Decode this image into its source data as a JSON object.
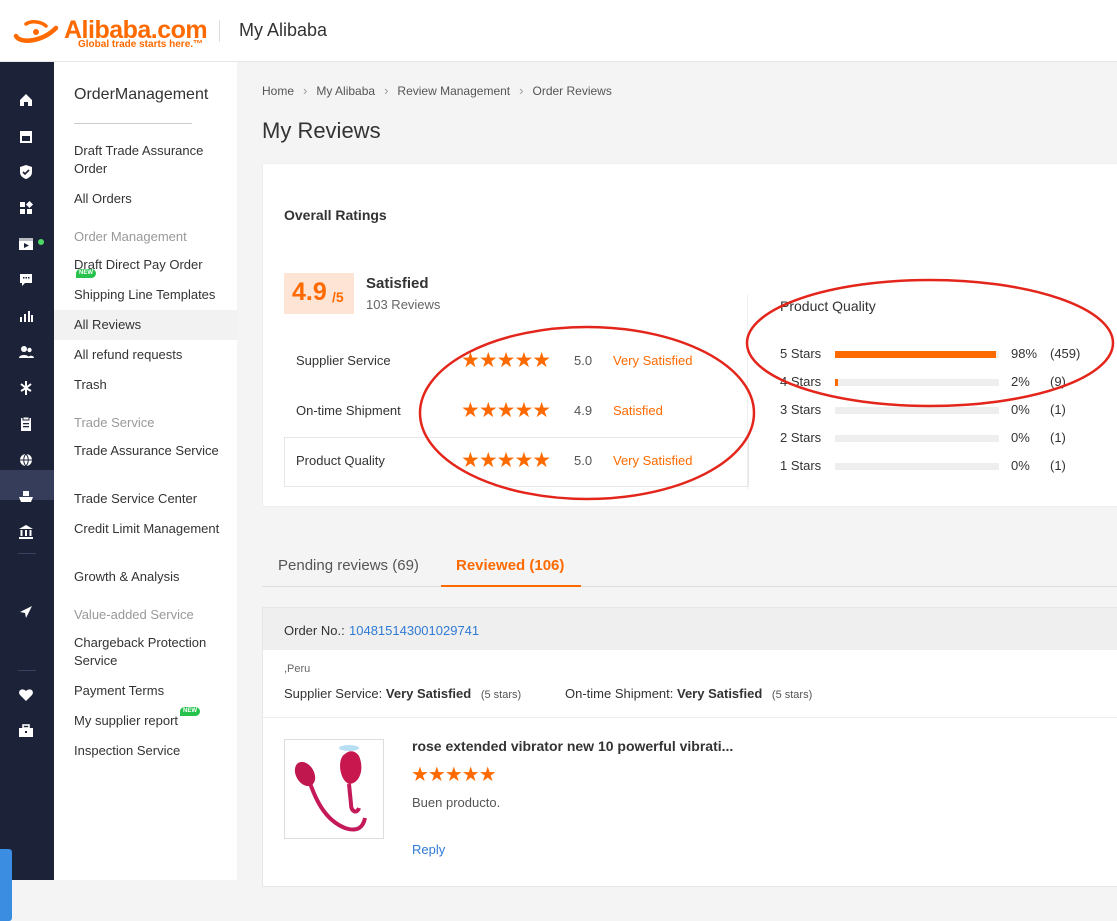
{
  "header": {
    "logo_text": "Alibaba.com",
    "logo_tagline": "Global trade starts here.™",
    "title": "My Alibaba"
  },
  "rail": {
    "icons": [
      "home-icon",
      "store-icon",
      "shield-icon",
      "apps-icon",
      "video-icon",
      "chat-icon",
      "chart-icon",
      "people-icon",
      "fork-icon",
      "clipboard-icon",
      "globe-icon",
      "ship-icon",
      "bank-icon",
      "send-icon",
      "heart-icon",
      "briefcase-icon"
    ]
  },
  "sidebar": {
    "title": "OrderManagement",
    "items": [
      {
        "label": "Draft Trade Assurance Order"
      },
      {
        "label": "All Orders"
      },
      {
        "label": "Order Management"
      },
      {
        "label": "Draft Direct Pay Order",
        "badge": "NEW"
      },
      {
        "label": "Shipping Line Templates"
      },
      {
        "label": "All Reviews"
      },
      {
        "label": "All refund requests"
      },
      {
        "label": "Trash"
      },
      {
        "label": "Trade Service"
      },
      {
        "label": "Trade Assurance Service"
      },
      {
        "label": "Trade Service Center"
      },
      {
        "label": "Credit Limit Management"
      },
      {
        "label": "Growth & Analysis"
      },
      {
        "label": "Value-added Service"
      },
      {
        "label": "Chargeback Protection Service"
      },
      {
        "label": "Payment Terms"
      },
      {
        "label": "My supplier report",
        "badge": "NEW"
      },
      {
        "label": "Inspection Service"
      }
    ]
  },
  "breadcrumb": [
    "Home",
    "My Alibaba",
    "Review Management",
    "Order Reviews"
  ],
  "page_title": "My Reviews",
  "overall": {
    "title": "Overall Ratings",
    "score": "4.9",
    "score_denominator": "/5",
    "label": "Satisfied",
    "reviews": "103 Reviews",
    "dimensions": [
      {
        "label": "Supplier Service",
        "stars": "★★★★★",
        "score": "5.0",
        "text": "Very Satisfied"
      },
      {
        "label": "On-time Shipment",
        "stars": "★★★★★",
        "score": "4.9",
        "text": "Satisfied"
      },
      {
        "label": "Product Quality",
        "stars": "★★★★★",
        "score": "5.0",
        "text": "Very Satisfied"
      }
    ]
  },
  "product_quality": {
    "title": "Product Quality",
    "rows": [
      {
        "label": "5  Stars",
        "fraction": 0.98,
        "pct": "98%",
        "count": "(459)"
      },
      {
        "label": "4  Stars",
        "fraction": 0.02,
        "pct": "2%",
        "count": "(9)"
      },
      {
        "label": "3  Stars",
        "fraction": 0,
        "pct": "0%",
        "count": "(1)"
      },
      {
        "label": "2  Stars",
        "fraction": 0,
        "pct": "0%",
        "count": "(1)"
      },
      {
        "label": "1  Stars",
        "fraction": 0,
        "pct": "0%",
        "count": "(1)"
      }
    ]
  },
  "tabs": [
    {
      "label": "Pending reviews (69)"
    },
    {
      "label": "Reviewed (106)"
    }
  ],
  "order": {
    "no_label": "Order No.:",
    "no": "104815143001029741",
    "location": ",Peru",
    "supplier_label": "Supplier Service:",
    "supplier_value": "Very Satisfied",
    "supplier_stars": "(5 stars)",
    "shipment_label": "On-time Shipment:",
    "shipment_value": "Very Satisfied",
    "shipment_stars": "(5 stars)",
    "product_name": "rose extended vibrator new 10 powerful vibrati...",
    "product_stars": "★★★★★",
    "review_text": "Buen producto.",
    "reply_label": "Reply"
  },
  "colors": {
    "accent": "#ff6a00",
    "link": "#2f7bd5",
    "rail_bg": "#1c2237",
    "annotation": "#e3251b"
  }
}
